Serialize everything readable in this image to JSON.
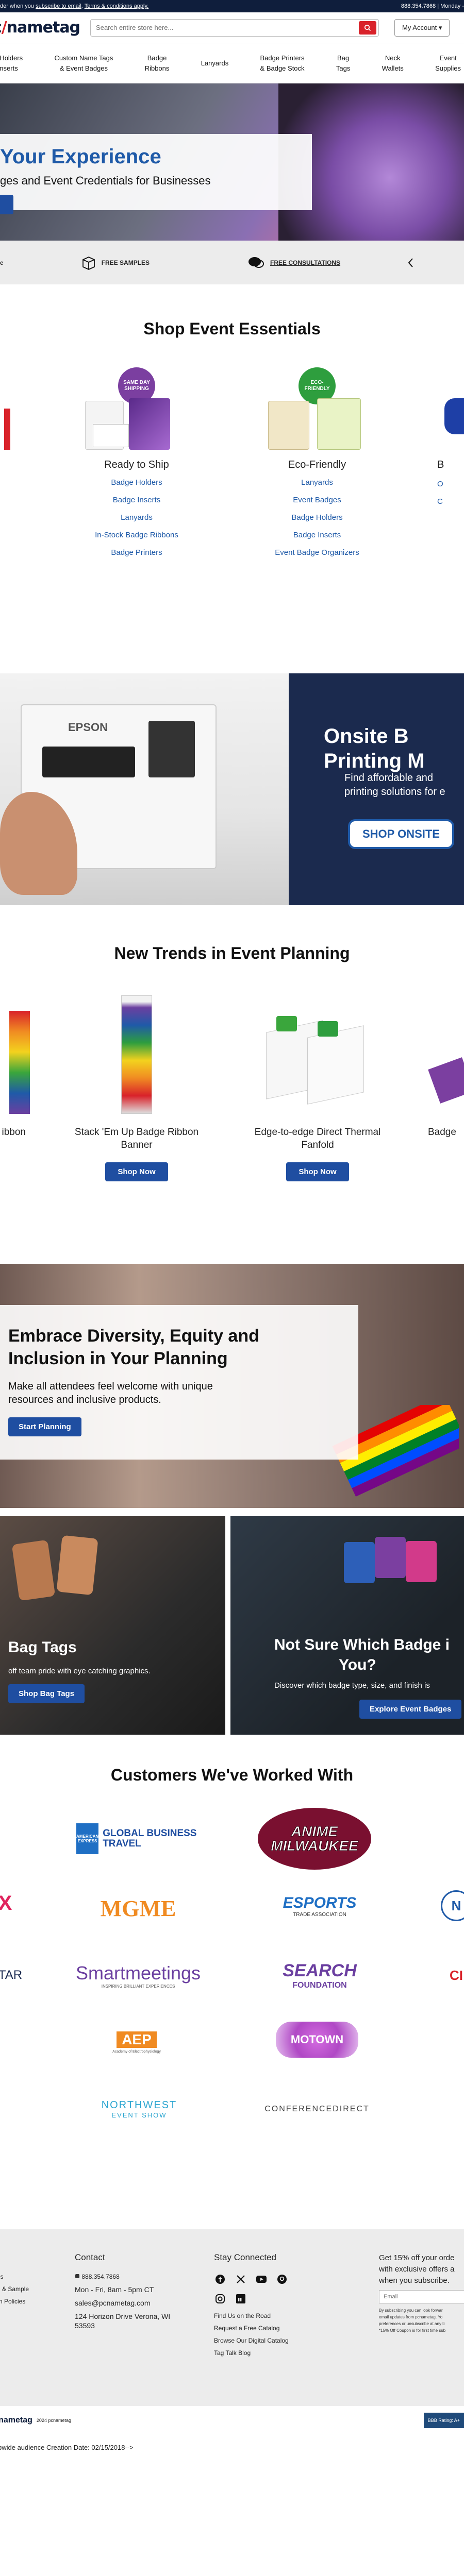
{
  "promo": {
    "left_pre": "der when you ",
    "left_link1": "subscribe to email",
    "left_mid": ".  ",
    "left_link2": "Terms & conditions apply.",
    "right": "888.354.7868  |  Monday -"
  },
  "header": {
    "logo_left": "c",
    "logo_slash": "/",
    "logo_right": "nametag",
    "search_placeholder": "Search entire store here...",
    "account_label": "My Account  ▾"
  },
  "nav": [
    {
      "line1": "dge Holders",
      "line2": "& Inserts"
    },
    {
      "line1": "Custom Name Tags",
      "line2": "& Event Badges"
    },
    {
      "line1": "Badge",
      "line2": "Ribbons"
    },
    {
      "line1": "Lanyards",
      "line2": ""
    },
    {
      "line1": "Badge Printers",
      "line2": "& Badge Stock"
    },
    {
      "line1": "Bag",
      "line2": "Tags"
    },
    {
      "line1": "Neck",
      "line2": "Wallets"
    },
    {
      "line1": "Event",
      "line2": "Supplies"
    }
  ],
  "hero": {
    "title": "Your Experience",
    "subtitle": "ges and Event Credentials for Businesses"
  },
  "benefits": [
    {
      "icon": "partial-icon",
      "label": "e"
    },
    {
      "icon": "box-icon",
      "label": "FREE SAMPLES"
    },
    {
      "icon": "chat-icon",
      "label": "FREE CONSULTATIONS"
    },
    {
      "icon": "partial-icon",
      "label": ""
    }
  ],
  "essentials": {
    "title": "Shop Event Essentials",
    "columns": [
      {
        "title": "Ready to Ship",
        "badge": "SAME DAY SHIPPING",
        "badge_color": "#7b3fa0",
        "links": [
          "Badge Holders",
          "Badge Inserts",
          "Lanyards",
          "In-Stock Badge Ribbons",
          "Badge Printers"
        ]
      },
      {
        "title": "Eco-Friendly",
        "badge": "ECO-FRIENDLY",
        "badge_color": "#2e9e3e",
        "links": [
          "Lanyards",
          "Event Badges",
          "Badge Holders",
          "Badge Inserts",
          "Event Badge Organizers"
        ]
      },
      {
        "title": "B",
        "links": [
          "",
          "",
          "",
          "O",
          "C"
        ]
      }
    ]
  },
  "onsite": {
    "title_line1": "Onsite B",
    "title_line2": "Printing M",
    "sub_line1": "Find affordable and",
    "sub_line2": "printing solutions for e",
    "button": "SHOP ONSITE",
    "printer_brand": "EPSON"
  },
  "trends": {
    "title": "New Trends in Event Planning",
    "items": [
      {
        "title": "ibbon",
        "button": ""
      },
      {
        "title": "Stack 'Em Up Badge Ribbon Banner",
        "button": "Shop Now"
      },
      {
        "title": "Edge-to-edge Direct Thermal Fanfold",
        "button": "Shop Now"
      },
      {
        "title": "Badge",
        "button": ""
      }
    ]
  },
  "diversity": {
    "title_line1": "Embrace Diversity, Equity and",
    "title_line2": "Inclusion in Your Planning",
    "sub_line1": "Make all attendees feel welcome with unique",
    "sub_line2": "resources and inclusive products.",
    "button": "Start Planning"
  },
  "dual": {
    "left": {
      "title": "Bag Tags",
      "sub": "off team pride with eye catching graphics.",
      "button": "Shop Bag Tags"
    },
    "right": {
      "title": "Not Sure Which Badge i",
      "title2": "You?",
      "sub": "Discover which badge type, size, and finish is",
      "button": "Explore Event Badges"
    }
  },
  "customers": {
    "title": "Customers We've Worked With",
    "logos": [
      {
        "name": "GLOBAL BUSINESS TRAVEL",
        "brand": "AMERICAN EXPRESS"
      },
      {
        "name": "ANIME MILWAUKEE"
      },
      {
        "name": "X"
      },
      {
        "name": "MGME"
      },
      {
        "name": "ESPORTS",
        "sub": "TRADE ASSOCIATION"
      },
      {
        "name": "N"
      },
      {
        "name": "TAR"
      },
      {
        "name": "Smartmeetings",
        "sub": "INSPIRING BRILLIANT EXPERIENCES"
      },
      {
        "name": "SEARCH",
        "sub": "FOUNDATION"
      },
      {
        "name": "CI"
      },
      {
        "name": "AEP",
        "sub": "Academy of Electrophysiology"
      },
      {
        "name": "MOTOWN"
      },
      {
        "name": "NORTHWEST",
        "sub": "EVENT SHOW"
      },
      {
        "name": "CONFERENCEDIRECT"
      }
    ]
  },
  "footer": {
    "col0": [
      "gs",
      "n & Sample",
      "",
      "rn Policies"
    ],
    "contact": {
      "title": "Contact",
      "phone": "888.354.7868",
      "hours": "Mon - Fri, 8am - 5pm CT",
      "email": "sales@pcnametag.com",
      "address1": "124 Horizon Drive Verona, WI",
      "address2": "53593"
    },
    "stay": {
      "title": "Stay Connected",
      "links": [
        "Find Us on the Road",
        "Request a Free Catalog",
        "Browse Our Digital Catalog",
        "Tag Talk Blog"
      ]
    },
    "offer": {
      "line1": "Get 15% off your orde",
      "line2": "with exclusive offers a",
      "line3": "when you subscribe.",
      "email_placeholder": "Email",
      "fine1": "By subscribing you can look forwar",
      "fine2": "email updates from pcnametag. Yo",
      "fine3": "preferences or unsubscribe at any ti",
      "fine4": "*15% Off Coupon is for first time sub"
    }
  },
  "bottom": {
    "logo_left": "pc",
    "logo_slash": "/",
    "logo_right": "nametag",
    "copyright": "2024 pcnametag",
    "bbb": "BBB Rating: A+"
  },
  "comment": "bwide audience Creation Date: 02/15/2018-->"
}
